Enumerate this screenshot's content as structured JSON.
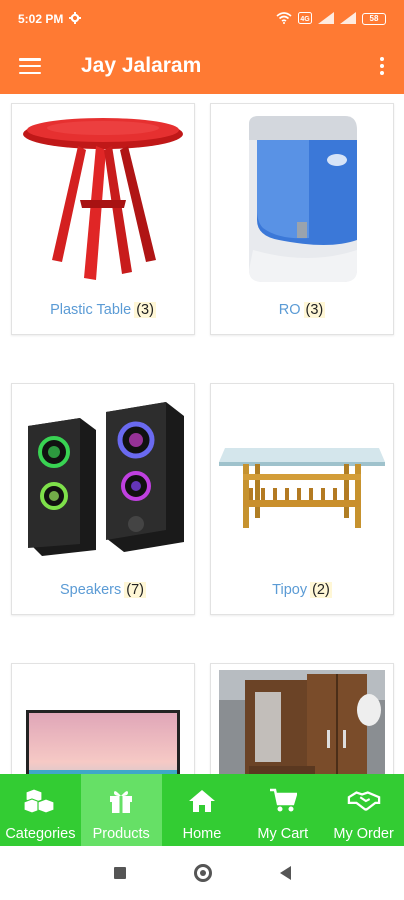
{
  "status_bar": {
    "time": "5:02 PM",
    "battery": "58"
  },
  "app_bar": {
    "title": "Jay Jalaram"
  },
  "categories": [
    {
      "name": "Plastic Table",
      "count": "(3)",
      "icon": "plastic-table-image"
    },
    {
      "name": "RO",
      "count": "(3)",
      "icon": "ro-purifier-image"
    },
    {
      "name": "Speakers",
      "count": "(7)",
      "icon": "speakers-image"
    },
    {
      "name": "Tipoy",
      "count": "(2)",
      "icon": "tipoy-table-image"
    },
    {
      "name": "",
      "count": "",
      "icon": "tv-image"
    },
    {
      "name": "",
      "count": "",
      "icon": "wardrobe-image"
    }
  ],
  "bottom_nav": [
    {
      "label": "Categories",
      "icon": "cubes-icon"
    },
    {
      "label": "Products",
      "icon": "gift-icon",
      "active": true
    },
    {
      "label": "Home",
      "icon": "home-icon"
    },
    {
      "label": "My Cart",
      "icon": "cart-icon"
    },
    {
      "label": "My Order",
      "icon": "handshake-icon"
    }
  ],
  "colors": {
    "primary": "#ff7a33",
    "nav": "#33cc33",
    "nav_active": "#66e066",
    "link": "#5b9bd5"
  }
}
